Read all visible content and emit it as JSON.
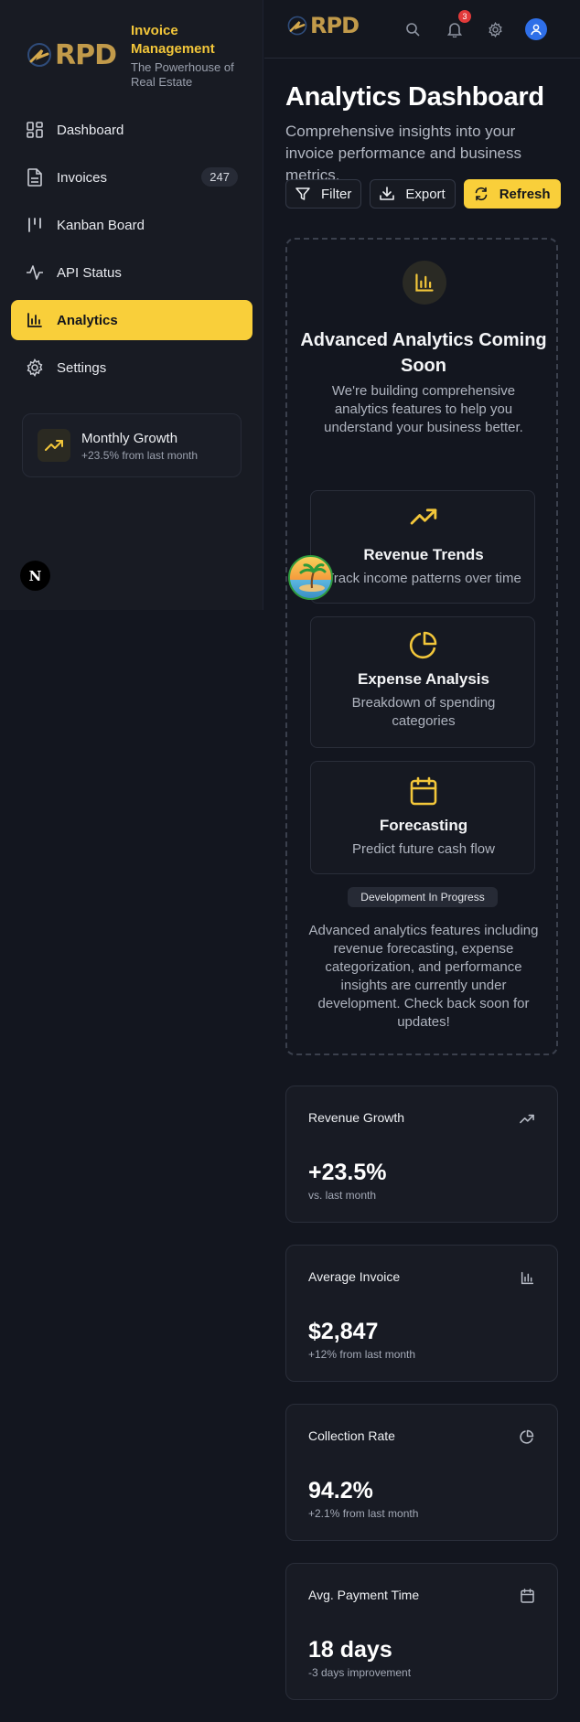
{
  "brand": {
    "logo": "RPD",
    "title": "Invoice Management",
    "subtitle": "The Powerhouse of Real Estate"
  },
  "sidebar": {
    "items": [
      {
        "label": "Dashboard",
        "icon": "dashboard-icon"
      },
      {
        "label": "Invoices",
        "icon": "file-text-icon",
        "badge": "247"
      },
      {
        "label": "Kanban Board",
        "icon": "kanban-icon"
      },
      {
        "label": "API Status",
        "icon": "activity-icon"
      },
      {
        "label": "Analytics",
        "icon": "bar-chart-icon",
        "active": true
      },
      {
        "label": "Settings",
        "icon": "gear-icon"
      }
    ],
    "growth_card": {
      "title": "Monthly Growth",
      "subtitle": "+23.5% from last month"
    },
    "next_badge": "N"
  },
  "topbar": {
    "logo": "RPD",
    "notification_count": "3"
  },
  "header": {
    "title": "Analytics Dashboard",
    "subtitle": "Comprehensive insights into your invoice performance and business metrics."
  },
  "actions": {
    "filter": "Filter",
    "export": "Export",
    "refresh": "Refresh"
  },
  "coming_soon": {
    "title": "Advanced Analytics Coming Soon",
    "description": "We're building comprehensive analytics features to help you understand your business better.",
    "features": [
      {
        "title": "Revenue Trends",
        "description": "Track income patterns over time",
        "icon": "trending-up-icon"
      },
      {
        "title": "Expense Analysis",
        "description": "Breakdown of spending categories",
        "icon": "pie-chart-icon"
      },
      {
        "title": "Forecasting",
        "description": "Predict future cash flow",
        "icon": "calendar-icon"
      }
    ],
    "status_pill": "Development In Progress",
    "footer": "Advanced analytics features including revenue forecasting, expense categorization, and performance insights are currently under development. Check back soon for updates!"
  },
  "stats": [
    {
      "label": "Revenue Growth",
      "value": "+23.5%",
      "sub": "vs. last month",
      "icon": "trending-up-icon"
    },
    {
      "label": "Average Invoice",
      "value": "$2,847",
      "sub": "+12% from last month",
      "icon": "bar-chart-icon"
    },
    {
      "label": "Collection Rate",
      "value": "94.2%",
      "sub": "+2.1% from last month",
      "icon": "pie-chart-icon"
    },
    {
      "label": "Avg. Payment Time",
      "value": "18 days",
      "sub": "-3 days improvement",
      "icon": "calendar-icon"
    }
  ],
  "colors": {
    "accent": "#f9cf3a",
    "background": "#13161f",
    "sidebar": "#181b23",
    "logo_gold": "#c19a4a",
    "notification": "#e23a3a",
    "avatar": "#2f6fe8"
  }
}
